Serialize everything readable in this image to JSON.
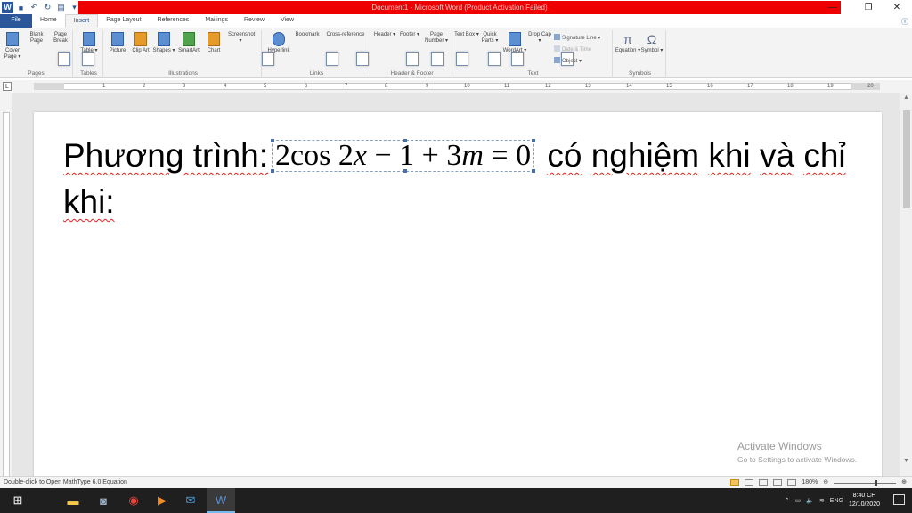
{
  "titlebar": {
    "title": "Document1 - Microsoft Word (Product Activation Failed)",
    "minimize": "—",
    "restore": "❐",
    "close": "✕"
  },
  "tabs": [
    "File",
    "Home",
    "Insert",
    "Page Layout",
    "References",
    "Mailings",
    "Review",
    "View"
  ],
  "active_tab": "Insert",
  "ribbon": {
    "pages": {
      "label": "Pages",
      "cover": "Cover Page ▾",
      "blank": "Blank Page",
      "break": "Page Break"
    },
    "tables": {
      "label": "Tables",
      "table": "Table ▾"
    },
    "illustrations": {
      "label": "Illustrations",
      "picture": "Picture",
      "clipart": "Clip Art",
      "shapes": "Shapes ▾",
      "smartart": "SmartArt",
      "chart": "Chart",
      "screenshot": "Screenshot ▾"
    },
    "links": {
      "label": "Links",
      "hyperlink": "Hyperlink",
      "bookmark": "Bookmark",
      "crossref": "Cross-reference"
    },
    "headerfooter": {
      "label": "Header & Footer",
      "header": "Header ▾",
      "footer": "Footer ▾",
      "pagenumber": "Page Number ▾"
    },
    "text": {
      "label": "Text",
      "textbox": "Text Box ▾",
      "quickparts": "Quick Parts ▾",
      "wordart": "WordArt ▾",
      "dropcap": "Drop Cap ▾",
      "signature": "Signature Line ▾",
      "datetime": "Date & Time",
      "object": "Object ▾"
    },
    "symbols": {
      "label": "Symbols",
      "equation": "Equation ▾",
      "symbol": "Symbol ▾"
    }
  },
  "ruler": {
    "numbers": [
      "1",
      "2",
      "3",
      "4",
      "5",
      "6",
      "7",
      "8",
      "9",
      "10",
      "11",
      "12",
      "13",
      "14",
      "15",
      "16",
      "17",
      "18",
      "19",
      "20"
    ]
  },
  "document": {
    "before_eq": "Phương trình:",
    "equation": {
      "a": "2",
      "cos": "cos",
      "b": "2",
      "x": "x",
      "rest1": " − 1 + 3",
      "m": "m",
      "rest2": " = 0"
    },
    "after_eq_words": [
      "có",
      "nghiệm",
      "khi",
      "và",
      "chỉ"
    ],
    "line2": "khi:"
  },
  "watermark": {
    "title": "Activate Windows",
    "subtitle": "Go to Settings to activate Windows."
  },
  "status": {
    "message": "Double-click to Open MathType 6.0 Equation",
    "zoom": "180%"
  },
  "taskbar": {
    "lang": "ENG",
    "time": "8:40 CH",
    "date": "12/10/2020"
  }
}
